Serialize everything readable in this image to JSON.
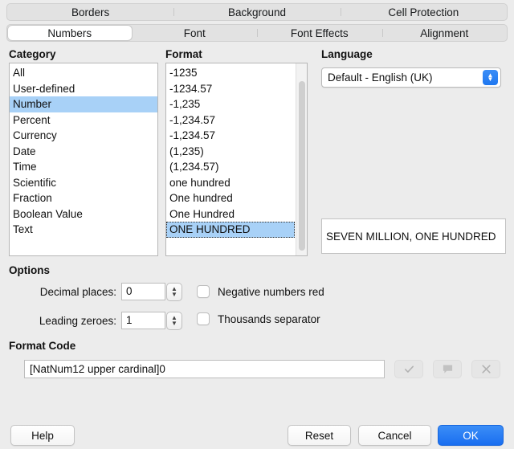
{
  "tabs": {
    "row1": [
      {
        "label": "Borders",
        "active": false
      },
      {
        "label": "Background",
        "active": false
      },
      {
        "label": "Cell Protection",
        "active": false
      }
    ],
    "row2": [
      {
        "label": "Numbers",
        "active": true
      },
      {
        "label": "Font",
        "active": false
      },
      {
        "label": "Font Effects",
        "active": false
      },
      {
        "label": "Alignment",
        "active": false
      }
    ]
  },
  "category": {
    "label": "Category",
    "items": [
      "All",
      "User-defined",
      "Number",
      "Percent",
      "Currency",
      "Date",
      "Time",
      "Scientific",
      "Fraction",
      "Boolean Value",
      "Text"
    ],
    "selected": "Number"
  },
  "format": {
    "label": "Format",
    "items": [
      "-1235",
      "-1234.57",
      "-1,235",
      "-1,234.57",
      "-1,234.57",
      "(1,235)",
      "(1,234.57)",
      "one hundred",
      "One hundred",
      "One Hundred",
      "ONE HUNDRED"
    ],
    "selected": "ONE HUNDRED"
  },
  "language": {
    "label": "Language",
    "value": "Default - English (UK)",
    "dropdown_icon": "chevron-up-down-icon"
  },
  "preview": {
    "text": "SEVEN MILLION, ONE HUNDRED"
  },
  "options": {
    "label": "Options",
    "decimal_places": {
      "label": "Decimal places:",
      "value": "0"
    },
    "leading_zeroes": {
      "label": "Leading zeroes:",
      "value": "1"
    },
    "negative_red": {
      "label": "Negative numbers red",
      "checked": false
    },
    "thousands_separator": {
      "label": "Thousands separator",
      "checked": false
    }
  },
  "format_code": {
    "label": "Format Code",
    "value": "[NatNum12 upper cardinal]0",
    "buttons": [
      {
        "name": "accept-format-button",
        "icon": "check-icon",
        "enabled": false
      },
      {
        "name": "add-comment-button",
        "icon": "comment-icon",
        "enabled": false
      },
      {
        "name": "remove-format-button",
        "icon": "close-icon",
        "enabled": false
      }
    ]
  },
  "footer": {
    "help": "Help",
    "reset": "Reset",
    "cancel": "Cancel",
    "ok": "OK"
  },
  "colors": {
    "accent": "#1a6ef0",
    "selection": "#a8d1f7",
    "dialog_bg": "#ececec"
  }
}
